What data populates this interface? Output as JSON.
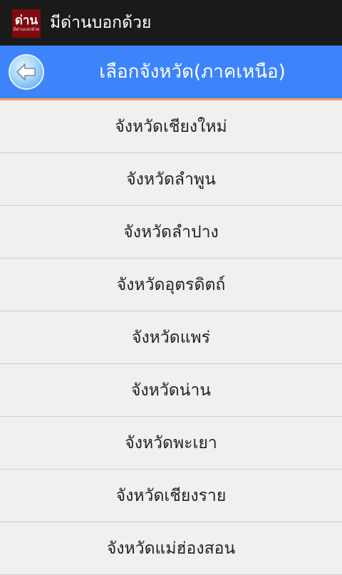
{
  "app_bar": {
    "icon_text": "ด่าน",
    "icon_subtext": "มีด่านบอกด้วย",
    "title": "มีด่านบอกด้วย"
  },
  "header": {
    "back_icon": "back-arrow-icon",
    "title": "เลือกจังหวัด(ภาคเหนือ)"
  },
  "provinces": [
    "จังหวัดเชียงใหม่",
    "จังหวัดลำพูน",
    "จังหวัดลำปาง",
    "จังหวัดอุตรดิตถ์",
    "จังหวัดแพร่",
    "จังหวัดน่าน",
    "จังหวัดพะเยา",
    "จังหวัดเชียงราย",
    "จังหวัดแม่ฮ่องสอน"
  ],
  "colors": {
    "app_bar": "#1a1a1a",
    "header": "#3d84fb",
    "accent": "#f2a552",
    "icon_bg": "#7d0b0f",
    "list_bg": "#f0f0f0",
    "divider": "#cfcfcf"
  }
}
